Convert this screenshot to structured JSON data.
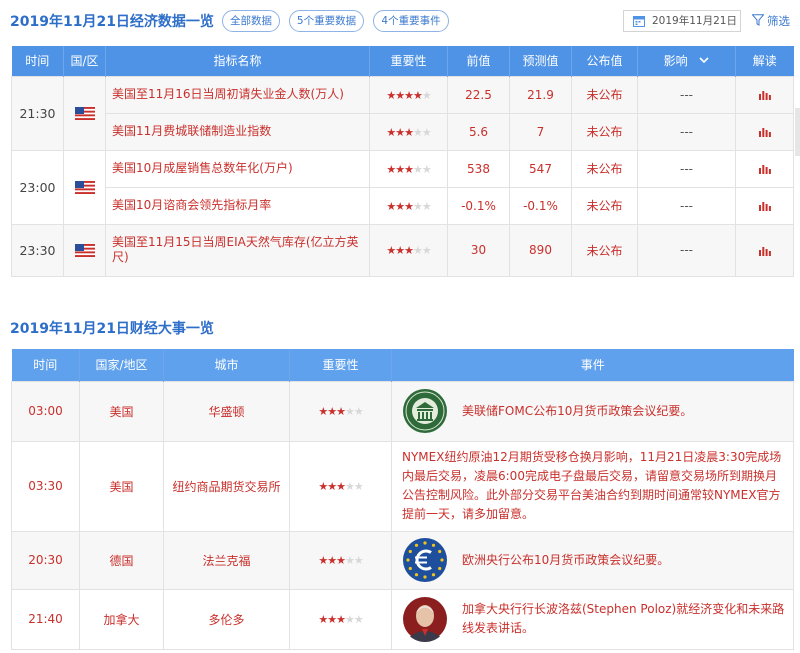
{
  "header": {
    "title": "2019年11月21日经济数据一览",
    "filters": [
      "全部数据",
      "5个重要数据",
      "4个重要事件"
    ],
    "date": "2019年11月21日",
    "filter_label": "筛选"
  },
  "econ_table": {
    "columns": [
      "时间",
      "国/区",
      "指标名称",
      "重要性",
      "前值",
      "预测值",
      "公布值",
      "影响",
      "解读"
    ],
    "rows": [
      {
        "time": "21:30",
        "country": "美国",
        "name": "美国至11月16日当周初请失业金人数(万人)",
        "stars": 4,
        "prev": "22.5",
        "forecast": "21.9",
        "actual": "未公布",
        "impact": "---"
      },
      {
        "time": "",
        "country": "",
        "name": "美国11月费城联储制造业指数",
        "stars": 3,
        "prev": "5.6",
        "forecast": "7",
        "actual": "未公布",
        "impact": "---"
      },
      {
        "time": "23:00",
        "country": "美国",
        "name": "美国10月成屋销售总数年化(万户)",
        "stars": 3,
        "prev": "538",
        "forecast": "547",
        "actual": "未公布",
        "impact": "---"
      },
      {
        "time": "",
        "country": "",
        "name": "美国10月谘商会领先指标月率",
        "stars": 3,
        "prev": "-0.1%",
        "forecast": "-0.1%",
        "actual": "未公布",
        "impact": "---"
      },
      {
        "time": "23:30",
        "country": "美国",
        "name": "美国至11月15日当周EIA天然气库存(亿立方英尺)",
        "stars": 3,
        "prev": "30",
        "forecast": "890",
        "actual": "未公布",
        "impact": "---"
      }
    ]
  },
  "events": {
    "title": "2019年11月21日财经大事一览",
    "columns": [
      "时间",
      "国家/地区",
      "城市",
      "重要性",
      "事件"
    ],
    "rows": [
      {
        "time": "03:00",
        "country": "美国",
        "city": "华盛顿",
        "stars": 3,
        "logo": "fed-seal-icon",
        "event": "美联储FOMC公布10月货币政策会议纪要。"
      },
      {
        "time": "03:30",
        "country": "美国",
        "city": "纽约商品期货交易所",
        "stars": 3,
        "logo": "",
        "event": "NYMEX纽约原油12月期货受移仓换月影响，11月21日凌晨3:30完成场内最后交易，凌晨6:00完成电子盘最后交易，请留意交易场所到期换月公告控制风险。此外部分交易平台美油合约到期时间通常较NYMEX官方提前一天，请多加留意。"
      },
      {
        "time": "20:30",
        "country": "德国",
        "city": "法兰克福",
        "stars": 3,
        "logo": "euro-logo-icon",
        "event": "欧洲央行公布10月货币政策会议纪要。"
      },
      {
        "time": "21:40",
        "country": "加拿大",
        "city": "多伦多",
        "stars": 3,
        "logo": "speaker-avatar-icon",
        "event": "加拿大央行行长波洛兹(Stephen Poloz)就经济变化和未来路线发表讲话。"
      }
    ]
  },
  "colors": {
    "accent": "#4f93e6",
    "title": "#2d6ec9",
    "data_red": "#c9302c"
  }
}
